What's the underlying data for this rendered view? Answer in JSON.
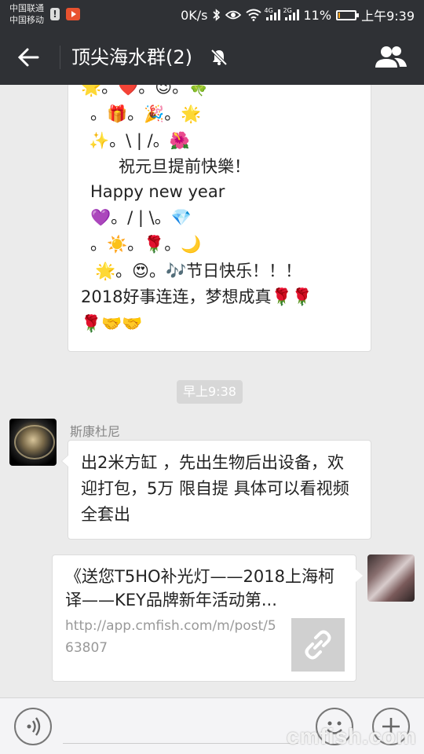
{
  "status_bar": {
    "carrier_1": "中国联通",
    "carrier_2": "中国移动",
    "net_speed": "0K/s",
    "net_4g": "4G",
    "net_2g": "2G",
    "battery_percent": "11%",
    "battery_level": 0.11,
    "time": "上午9:39"
  },
  "header": {
    "title": "顶尖海水群(2)",
    "icons": [
      "back-arrow-icon",
      "mute-bell-icon",
      "members-icon"
    ]
  },
  "messages": {
    "greeting": {
      "line1": "🌟。❤️。😉。🍀",
      "line2": "。🎁。🎉。🌟",
      "line3": "✨。\\ | /。🌺",
      "line4": "祝元旦提前快樂！",
      "line5": "Happy new year",
      "line6": "💜。/ | \\。💎",
      "line7": "。☀️。🌹。🌙",
      "line8": "🌟。😍。🎶节日快乐！！！",
      "line9": "2018好事连连，梦想成真🌹🌹",
      "line10": "🌹🤝🤝"
    },
    "timestamp": "早上9:38",
    "sender_name": "斯康杜尼",
    "text_message": "出2米方缸 ，先出生物后出设备，欢迎打包，5万 限自提 具体可以看视频 全套出",
    "link_card": {
      "title": "《送您T5HO补光灯——2018上海柯译——KEY品牌新年活动第...",
      "url": "http://app.cmfish.com/m/post/563807",
      "thumb_icon": "link-icon"
    }
  },
  "input_bar": {
    "icons": [
      "voice-icon",
      "emoji-icon",
      "plus-icon"
    ]
  },
  "watermark": "cmfish.com"
}
